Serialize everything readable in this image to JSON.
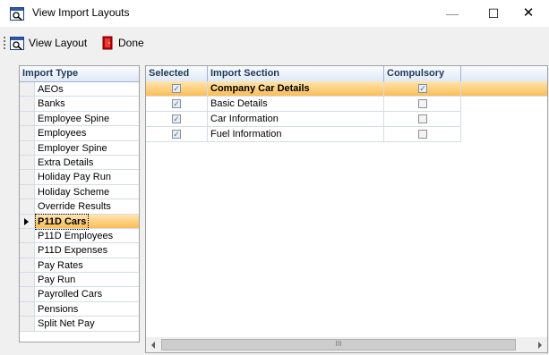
{
  "window": {
    "title": "View Import Layouts",
    "minimize_glyph": "—",
    "maximize_glyph": "☐",
    "close_glyph": "✕"
  },
  "toolbar": {
    "view_layout_label": "View Layout",
    "done_label": "Done"
  },
  "import_type": {
    "header": "Import Type",
    "items": [
      {
        "label": "AEOs"
      },
      {
        "label": "Banks"
      },
      {
        "label": "Employee Spine"
      },
      {
        "label": "Employees"
      },
      {
        "label": "Employer Spine"
      },
      {
        "label": "Extra Details"
      },
      {
        "label": "Holiday Pay Run"
      },
      {
        "label": "Holiday Scheme"
      },
      {
        "label": "Override Results"
      },
      {
        "label": "P11D Cars",
        "selected": true
      },
      {
        "label": "P11D Employees"
      },
      {
        "label": "P11D Expenses"
      },
      {
        "label": "Pay Rates"
      },
      {
        "label": "Pay Run"
      },
      {
        "label": "Payrolled Cars"
      },
      {
        "label": "Pensions"
      },
      {
        "label": "Split Net Pay"
      }
    ]
  },
  "sections_grid": {
    "columns": [
      "Selected",
      "Import Section",
      "Compulsory"
    ],
    "rows": [
      {
        "selected": true,
        "section": "Company Car Details",
        "compulsory": true,
        "highlighted": true
      },
      {
        "selected": true,
        "section": "Basic Details",
        "compulsory": false
      },
      {
        "selected": true,
        "section": "Car Information",
        "compulsory": false
      },
      {
        "selected": true,
        "section": "Fuel Information",
        "compulsory": false
      }
    ],
    "scroll_thumb_glyph": "III"
  },
  "colors": {
    "selection_top": "#ffe5b0",
    "selection_bottom": "#fcbd56",
    "header_text": "#1e395b",
    "done_icon": "#c00000"
  }
}
